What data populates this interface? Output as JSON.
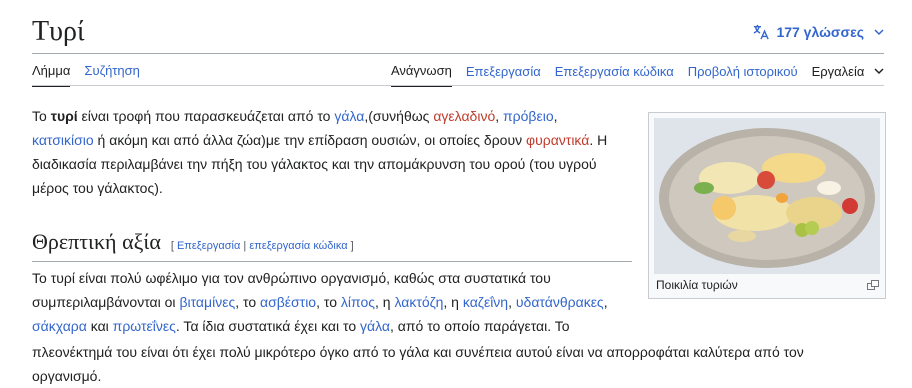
{
  "page": {
    "title": "Τυρί",
    "languages_label": "177 γλώσσες"
  },
  "tabs": {
    "left": [
      "Λήμμα",
      "Συζήτηση"
    ],
    "right": [
      "Ανάγνωση",
      "Επεξεργασία",
      "Επεξεργασία κώδικα",
      "Προβολή ιστορικού",
      "Εργαλεία"
    ]
  },
  "intro": {
    "t1": "Το ",
    "bold": "τυρί",
    "t2": " είναι τροφή που παρασκευάζεται από το ",
    "link_gala": "γάλα",
    "t3": ",(συνήθως ",
    "link_ageladino": "αγελαδινό",
    "t4": ", ",
    "link_provio": "πρόβειο",
    "t5": ",",
    "link_katsikisio": "κατσικίσιο",
    "t6": " ή ακόμη και από άλλα ζώα)με την επίδραση ουσιών, οι οποίες δρουν ",
    "link_fytantika": "φυραντικά",
    "t7": ". Η διαδικασία περιλαμβάνει την πήξη του γάλακτος και την απομάκρυνση του ορού (του υγρού μέρος του γάλακτος)."
  },
  "section": {
    "heading": "Θρεπτική αξία",
    "edit_open": "[ ",
    "edit_link": "Επεξεργασία",
    "edit_sep": " | ",
    "edit_code_link": "επεξεργασία κώδικα",
    "edit_close": " ]"
  },
  "body2": {
    "t1": "Το τυρί είναι πολύ ωφέλιμο για τον ανθρώπινο οργανισμό, καθώς στα συστατικά του συμπεριλαμβάνονται οι ",
    "vitamines": "βιταμίνες",
    "c1": ", το ",
    "asvestio": "ασβέστιο",
    "c2": ", το ",
    "lipos": "λίπος",
    "c3": ", η ",
    "laktozi": "λακτόζη",
    "c4": ", η ",
    "kafeini": "καζεΐνη",
    "c5": ", ",
    "ydatanthrakes": "υδατάνθρακες",
    "c6": ",",
    "sakxara": "σάκχαρα",
    "c7": " και ",
    "proteines": "πρωτεΐνες",
    "c8": ". Τα ίδια συστατικά έχει και το ",
    "gala": "γάλα",
    "c9": ", από το οποίο παράγεται. Το",
    "long": "πλεονέκτημά του είναι ότι έχει πολύ μικρότερο όγκο από το γάλα και συνέπεια αυτού είναι να απορροφάται καλύτερα από τον οργανισμό."
  },
  "figure": {
    "caption": "Ποικιλία τυριών"
  },
  "colors": {
    "link": "#3366cc",
    "redlink": "#bf3c2c",
    "text": "#202122"
  }
}
